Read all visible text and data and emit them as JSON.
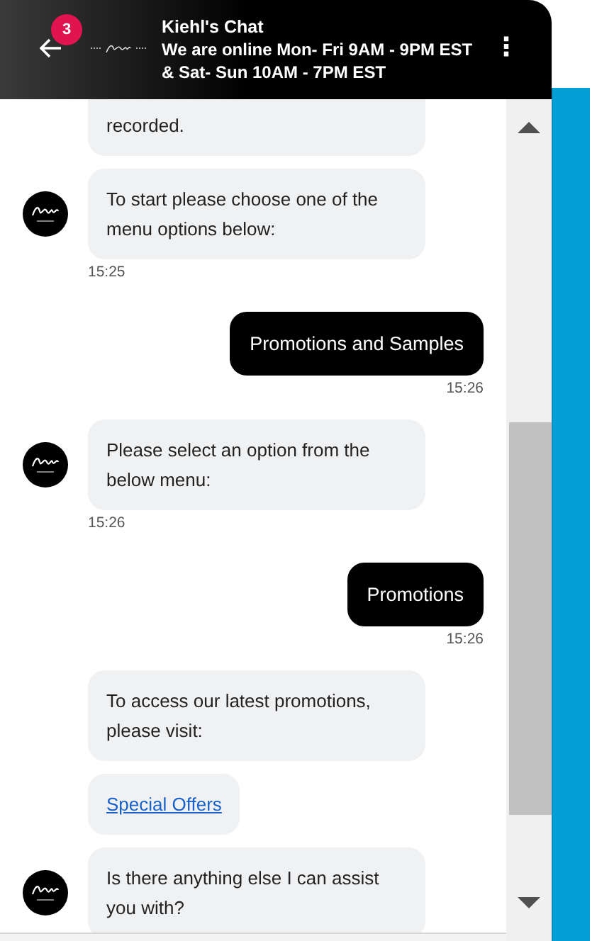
{
  "header": {
    "badge": "3",
    "title": "Kiehl's Chat",
    "status": "We are online Mon- Fri 9AM - 9PM EST & Sat- Sun 10AM - 7PM EST",
    "menu": "⋮"
  },
  "messages": [
    {
      "kind": "agent",
      "text": "recorded.",
      "avatar": false
    },
    {
      "kind": "agent",
      "text": "To start please choose one of the menu options below:",
      "avatar": true,
      "time": "15:25"
    },
    {
      "kind": "user",
      "text": "Promotions and Samples",
      "time": "15:26"
    },
    {
      "kind": "agent",
      "text": "Please select an option from the below menu:",
      "avatar": true,
      "time": "15:26"
    },
    {
      "kind": "user",
      "text": "Promotions",
      "time": "15:26"
    },
    {
      "kind": "agent",
      "text": "To access our latest promotions, please visit:",
      "avatar": false
    },
    {
      "kind": "link",
      "text": "Special Offers"
    },
    {
      "kind": "agent",
      "text": "Is there anything else I can assist you with?",
      "avatar": true
    }
  ]
}
